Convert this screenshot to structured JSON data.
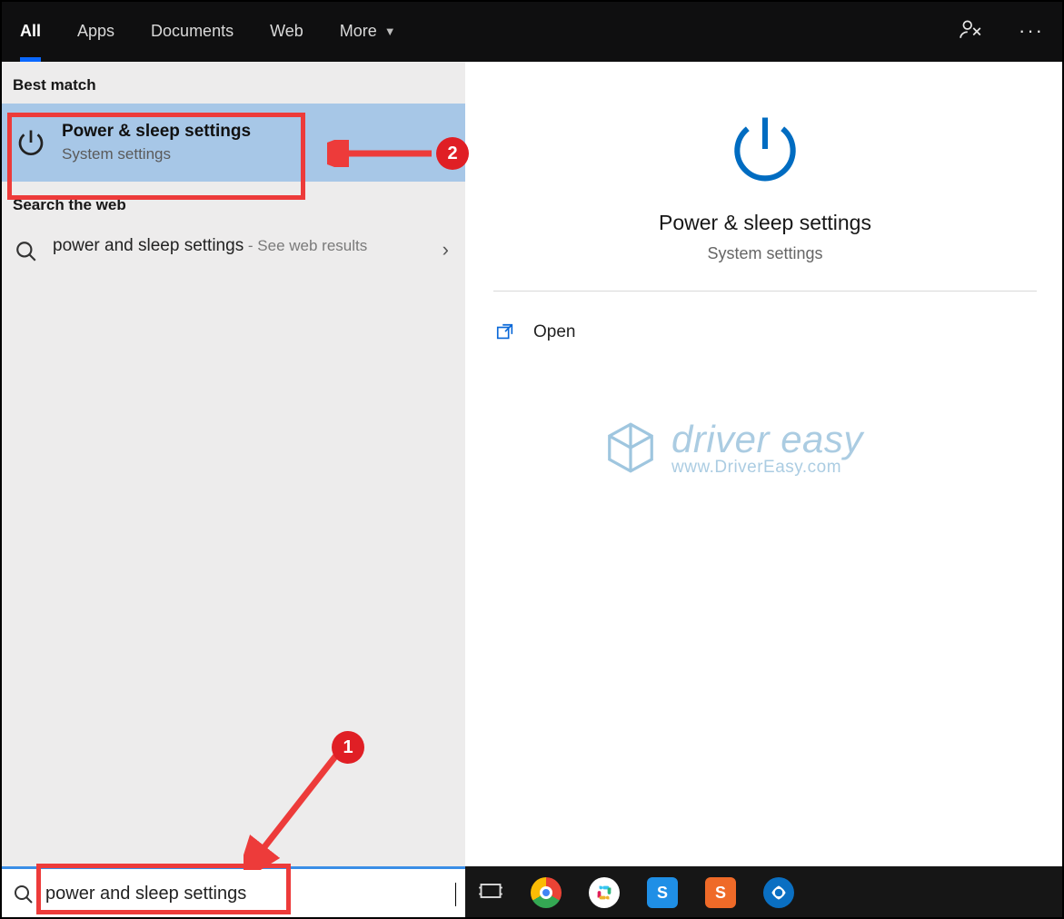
{
  "tabs": {
    "all": "All",
    "apps": "Apps",
    "documents": "Documents",
    "web": "Web",
    "more": "More"
  },
  "sections": {
    "best_match": "Best match",
    "search_web": "Search the web"
  },
  "best_match": {
    "title": "Power & sleep settings",
    "subtitle": "System settings"
  },
  "web_result": {
    "query": "power and sleep settings",
    "suffix": " - See web results"
  },
  "preview": {
    "title": "Power & sleep settings",
    "subtitle": "System settings",
    "open_label": "Open"
  },
  "watermark": {
    "brand": "driver easy",
    "url": "www.DriverEasy.com"
  },
  "search": {
    "value": "power and sleep settings"
  },
  "annotations": {
    "step1": "1",
    "step2": "2"
  },
  "colors": {
    "accent": "#0a68ff",
    "highlight_bg": "#a7c7e7",
    "anno_red": "#ed3b3a"
  }
}
